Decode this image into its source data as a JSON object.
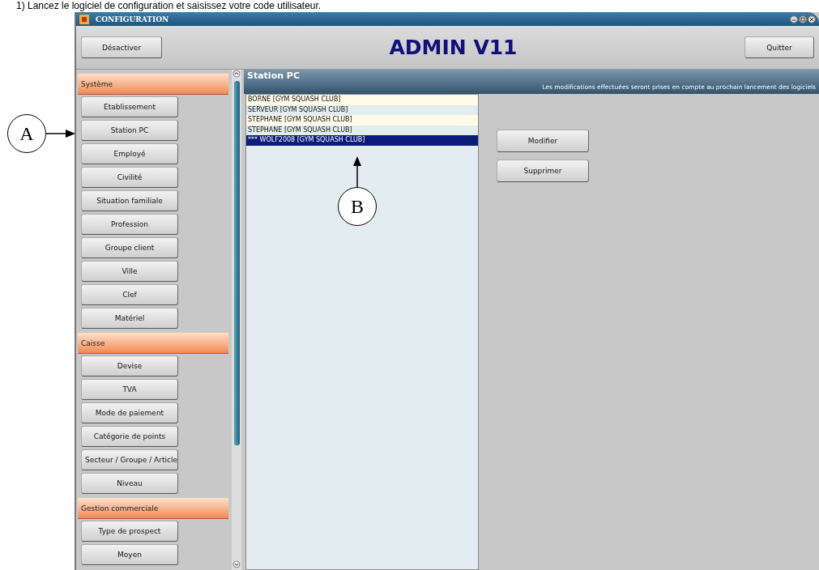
{
  "instruction": "1)   Lancez le logiciel de configuration et saisissez votre code utilisateur.",
  "window": {
    "title": "CONFIGURATION"
  },
  "toolbar": {
    "left_button": "Désactiver",
    "heading": "ADMIN V11",
    "right_button": "Quitter"
  },
  "sidebar": {
    "sections": [
      {
        "title": "Système",
        "items": [
          {
            "label": "Etablissement"
          },
          {
            "label": "Station PC"
          },
          {
            "label": "Employé"
          },
          {
            "label": "Civilité"
          },
          {
            "label": "Situation familiale"
          },
          {
            "label": "Profession"
          },
          {
            "label": "Groupe client"
          },
          {
            "label": "Ville"
          },
          {
            "label": "Clef"
          },
          {
            "label": "Matériel"
          }
        ]
      },
      {
        "title": "Caisse",
        "items": [
          {
            "label": "Devise"
          },
          {
            "label": "TVA"
          },
          {
            "label": "Mode de paiement"
          },
          {
            "label": "Catégorie de points"
          },
          {
            "label": "Secteur / Groupe / Article"
          },
          {
            "label": "Niveau"
          }
        ]
      },
      {
        "title": "Gestion commerciale",
        "items": [
          {
            "label": "Type de prospect"
          },
          {
            "label": "Moyen"
          }
        ]
      }
    ]
  },
  "panel": {
    "title": "Station PC",
    "notice": "Les modifications effectuées seront prises en compte au prochain lancement des logiciels",
    "rows": [
      {
        "label": "BORNE [GYM SQUASH CLUB]",
        "selected": false
      },
      {
        "label": "SERVEUR [GYM SQUASH CLUB]",
        "selected": false
      },
      {
        "label": "STEPHANE [GYM SQUASH CLUB]",
        "selected": false
      },
      {
        "label": "STEPHANE [GYM SQUASH CLUB]",
        "selected": false
      },
      {
        "label": "*** WOLF2008 [GYM SQUASH CLUB]",
        "selected": true
      }
    ],
    "buttons": [
      "Modifier",
      "Supprimer"
    ]
  },
  "annotations": [
    {
      "label": "A"
    },
    {
      "label": "B"
    }
  ]
}
